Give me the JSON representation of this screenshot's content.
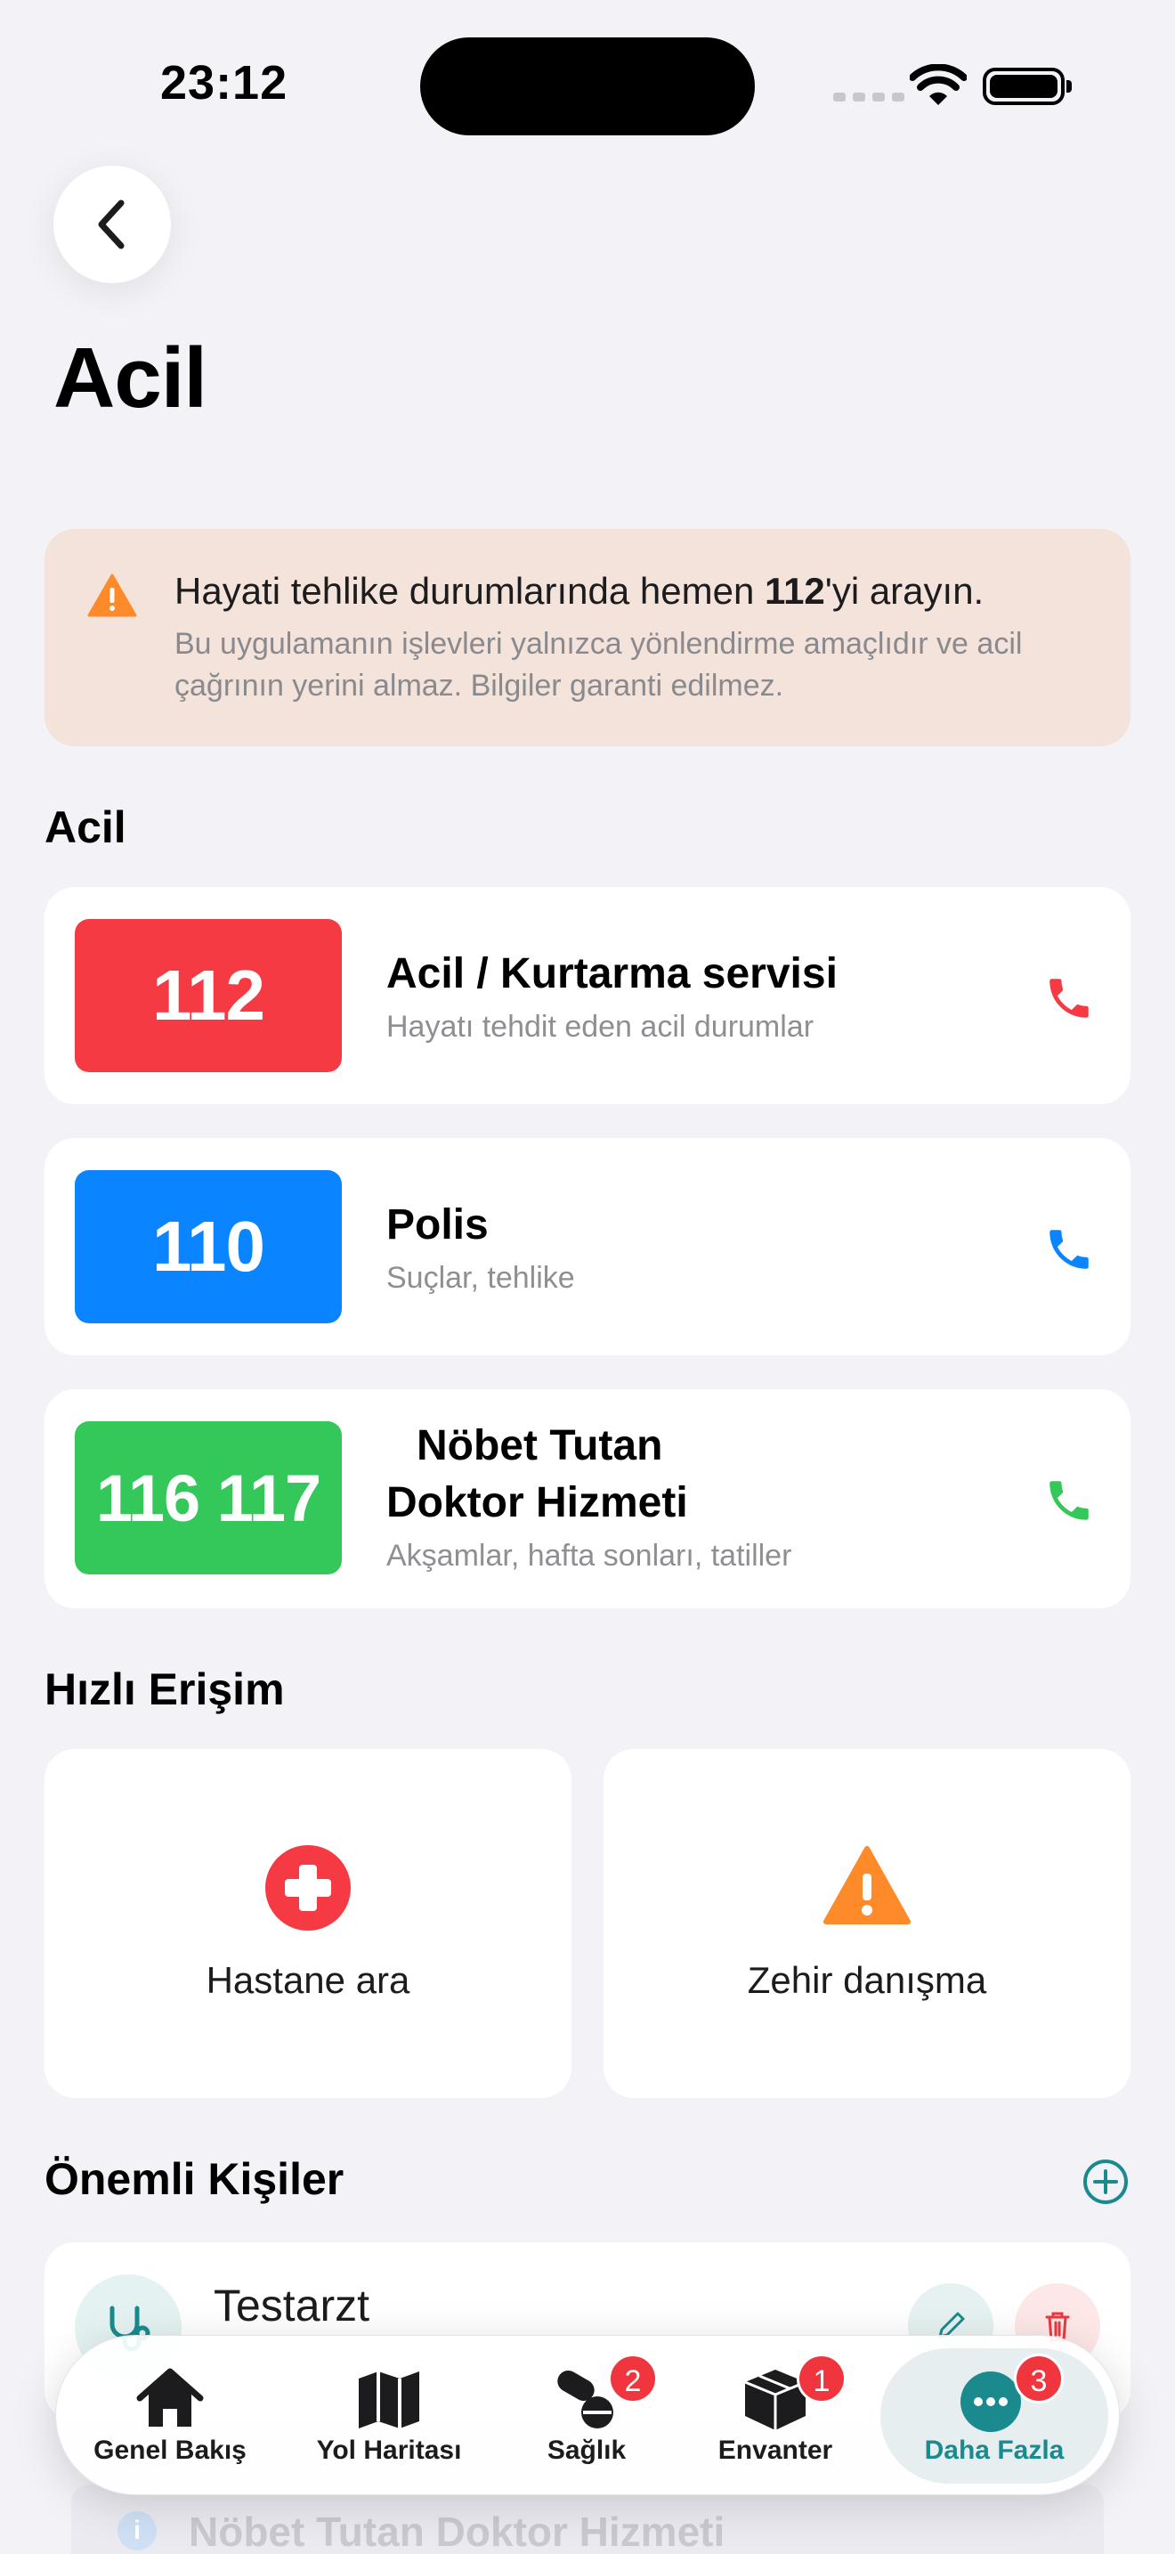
{
  "status_bar": {
    "time": "23:12"
  },
  "header": {
    "title": "Acil"
  },
  "warning": {
    "title_pre": "Hayati tehlike durumlarında hemen ",
    "title_number": "112",
    "title_post": "'yi arayın.",
    "body": "Bu uygulamanın işlevleri yalnızca yönlendirme amaçlıdır ve acil çağrının yerini almaz. Bilgiler garanti edilmez."
  },
  "emergency": {
    "section_title": "Acil",
    "items": [
      {
        "number": "112",
        "title": "Acil / Kurtarma servisi",
        "subtitle": "Hayatı tehdit eden acil durumlar",
        "color": "#f63a43",
        "phone_color": "#f63a43"
      },
      {
        "number": "110",
        "title": "Polis",
        "subtitle": "Suçlar, tehlike",
        "color": "#0a84ff",
        "phone_color": "#0a84ff"
      },
      {
        "number": "116 117",
        "title_line1": "Nöbet Tutan",
        "title_line2": "Doktor Hizmeti",
        "subtitle": "Akşamlar, hafta sonları, tatiller",
        "color": "#34c759",
        "phone_color": "#34c759"
      }
    ]
  },
  "quick_access": {
    "section_title": "Hızlı Erişim",
    "items": [
      {
        "label": "Hastane ara",
        "icon": "hospital-cross-icon",
        "color": "#f63a43"
      },
      {
        "label": "Zehir danışma",
        "icon": "warning-triangle-icon",
        "color": "#ff8a2a"
      }
    ]
  },
  "contacts": {
    "section_title": "Önemli Kişiler",
    "accent": "#1b8a8f",
    "items": [
      {
        "name": "Testarzt",
        "icon": "stethoscope-icon"
      }
    ],
    "info_strip": "Nöbet Tutan Doktor Hizmeti"
  },
  "tab_bar": {
    "tabs": [
      {
        "label": "Genel Bakış",
        "icon": "house-icon",
        "badge": ""
      },
      {
        "label": "Yol Haritası",
        "icon": "map-icon",
        "badge": ""
      },
      {
        "label": "Sağlık",
        "icon": "pills-icon",
        "badge": "2"
      },
      {
        "label": "Envanter",
        "icon": "box-icon",
        "badge": "1"
      },
      {
        "label": "Daha Fazla",
        "icon": "more-icon",
        "badge": "3",
        "active": true
      }
    ],
    "active_color": "#1b8a8f",
    "badge_color": "#f0353e"
  }
}
